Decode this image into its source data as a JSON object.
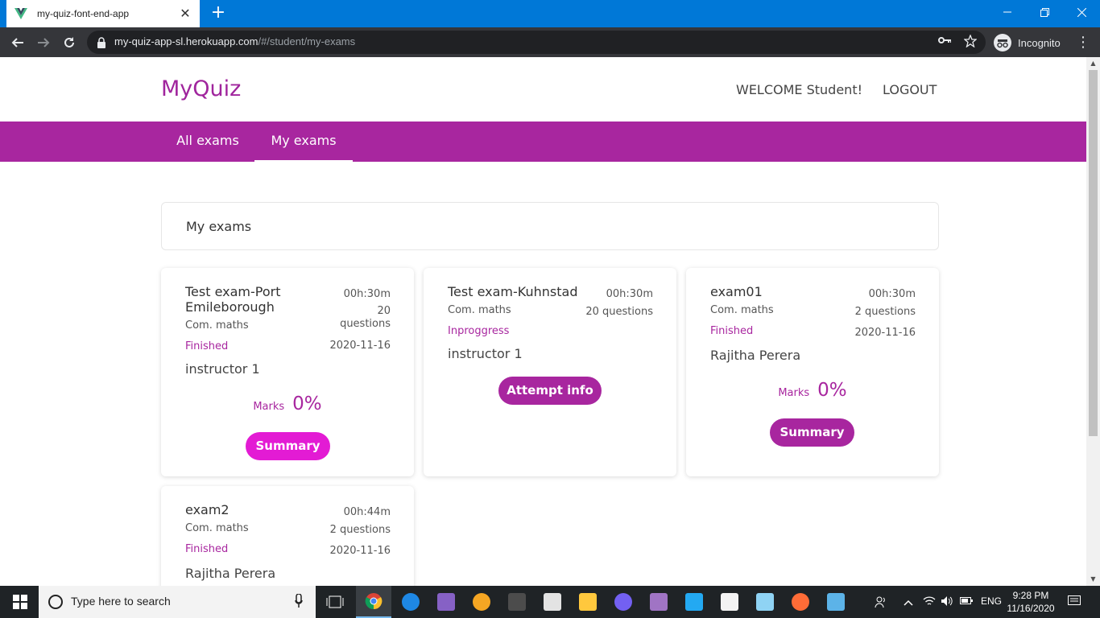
{
  "browser": {
    "tab_title": "my-quiz-font-end-app",
    "tab_close": "✕",
    "new_tab": "+",
    "url_host": "my-quiz-app-sl.herokuapp.com",
    "url_path": "/#/student/my-exams",
    "profile_label": "Incognito"
  },
  "app": {
    "brand": "MyQuiz",
    "welcome": "WELCOME Student!",
    "logout": "LOGOUT",
    "nav_tabs": [
      {
        "label": "All exams",
        "active": false
      },
      {
        "label": "My exams",
        "active": true
      }
    ],
    "section_title": "My exams",
    "accent_color": "#a8269f",
    "exams": [
      {
        "title": "Test exam-Port Emileborough",
        "subject": "Com. maths",
        "status": "Finished",
        "instructor": "instructor 1",
        "duration": "00h:30m",
        "questions": "20 questions",
        "date": "2020-11-16",
        "marks_label": "Marks",
        "marks": "0%",
        "button": "Summary"
      },
      {
        "title": "Test exam-Kuhnstad",
        "subject": "Com. maths",
        "status": "Inproggress",
        "instructor": "instructor 1",
        "duration": "00h:30m",
        "questions": "20 questions",
        "button": "Attempt info"
      },
      {
        "title": "exam01",
        "subject": "Com. maths",
        "status": "Finished",
        "instructor": "Rajitha Perera",
        "duration": "00h:30m",
        "questions": "2 questions",
        "date": "2020-11-16",
        "marks_label": "Marks",
        "marks": "0%",
        "button": "Summary"
      },
      {
        "title": "exam2",
        "subject": "Com. maths",
        "status": "Finished",
        "instructor": "Rajitha Perera",
        "duration": "00h:44m",
        "questions": "2 questions",
        "date": "2020-11-16"
      }
    ]
  },
  "taskbar": {
    "search_placeholder": "Type here to search",
    "language": "ENG",
    "time": "9:28 PM",
    "date": "11/16/2020"
  }
}
